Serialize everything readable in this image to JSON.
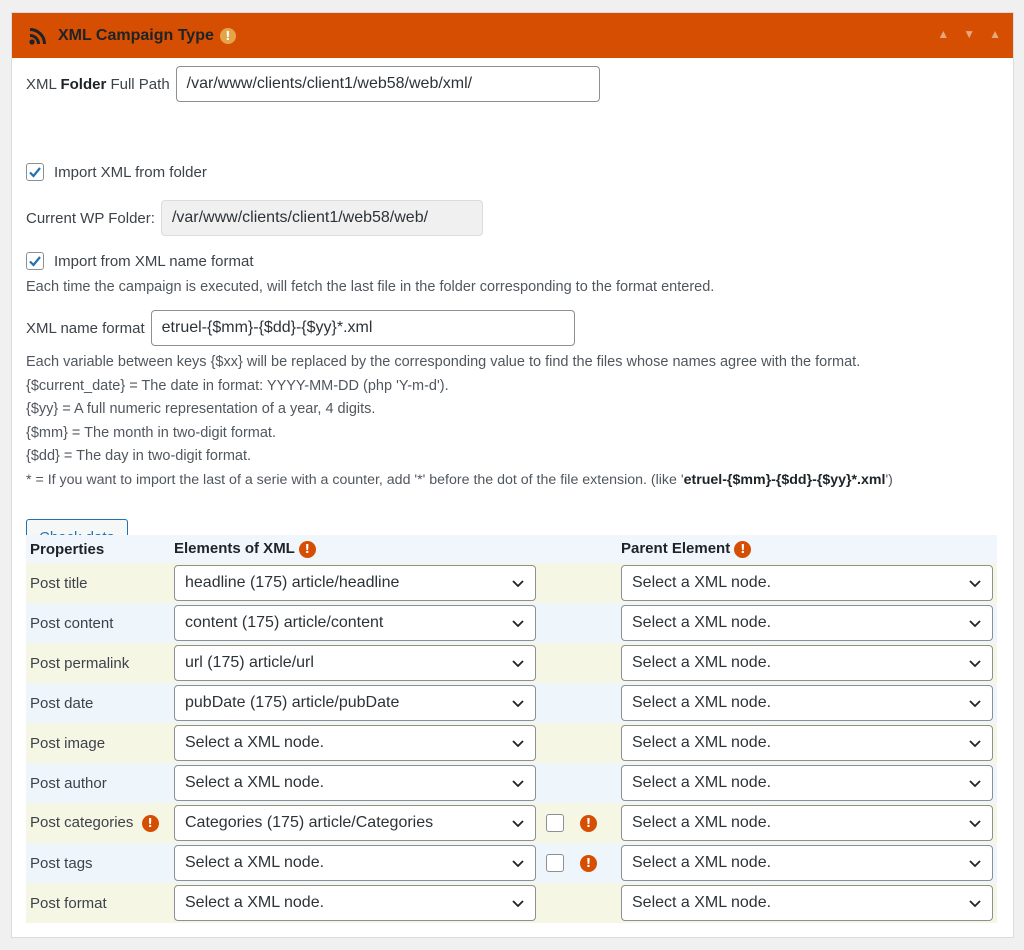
{
  "header": {
    "title": "XML Campaign Type",
    "controls": [
      "▲",
      "▼",
      "▲"
    ]
  },
  "folder": {
    "label_prefix": "XML ",
    "label_bold": "Folder",
    "label_suffix": " Full Path",
    "value": "/var/www/clients/client1/web58/web/xml/"
  },
  "import_folder": {
    "label": "Import XML from folder",
    "checked": true
  },
  "wp_folder": {
    "label": "Current WP Folder:",
    "value": "/var/www/clients/client1/web58/web/"
  },
  "import_name_format": {
    "label": "Import from XML name format",
    "checked": true,
    "help": "Each time the campaign is executed, will fetch the last file in the folder corresponding to the format entered."
  },
  "name_format": {
    "label": "XML name format",
    "value": "etruel-{$mm}-{$dd}-{$yy}*.xml"
  },
  "help_lines": [
    "Each variable between keys {$xx} will be replaced by the corresponding value to find the files whose names agree with the format.",
    "{$current_date} = The date in format: YYYY-MM-DD (php 'Y-m-d').",
    "{$yy} = A full numeric representation of a year, 4 digits.",
    "{$mm} = The month in two-digit format.",
    "{$dd} = The day in two-digit format."
  ],
  "help_last": {
    "prefix": "* = If you want to import the last of a serie with a counter, add '*' before the dot of the file extension. (like '",
    "bold": "etruel-{$mm}-{$dd}-{$yy}*.xml",
    "suffix": "')"
  },
  "check_button": "Check data",
  "table": {
    "headers": {
      "properties": "Properties",
      "elements": "Elements of XML",
      "parent": "Parent Element"
    },
    "rows": [
      {
        "property": "Post title",
        "element": "headline (175) article/headline",
        "parent": "Select a XML node."
      },
      {
        "property": "Post content",
        "element": "content (175) article/content",
        "parent": "Select a XML node."
      },
      {
        "property": "Post permalink",
        "element": "url (175) article/url",
        "parent": "Select a XML node."
      },
      {
        "property": "Post date",
        "element": "pubDate (175) article/pubDate",
        "parent": "Select a XML node."
      },
      {
        "property": "Post image",
        "element": "Select a XML node.",
        "parent": "Select a XML node."
      },
      {
        "property": "Post author",
        "element": "Select a XML node.",
        "parent": "Select a XML node."
      },
      {
        "property": "Post categories",
        "element": "Categories (175) article/Categories",
        "parent": "Select a XML node."
      },
      {
        "property": "Post tags",
        "element": "Select a XML node.",
        "parent": "Select a XML node."
      },
      {
        "property": "Post format",
        "element": "Select a XML node.",
        "parent": "Select a XML node."
      }
    ]
  },
  "warn_glyph": "!",
  "colors": {
    "header": "#d54e02",
    "accent": "#2271b1",
    "row_a": "#f6f6e4",
    "row_b": "#eef5fb"
  }
}
